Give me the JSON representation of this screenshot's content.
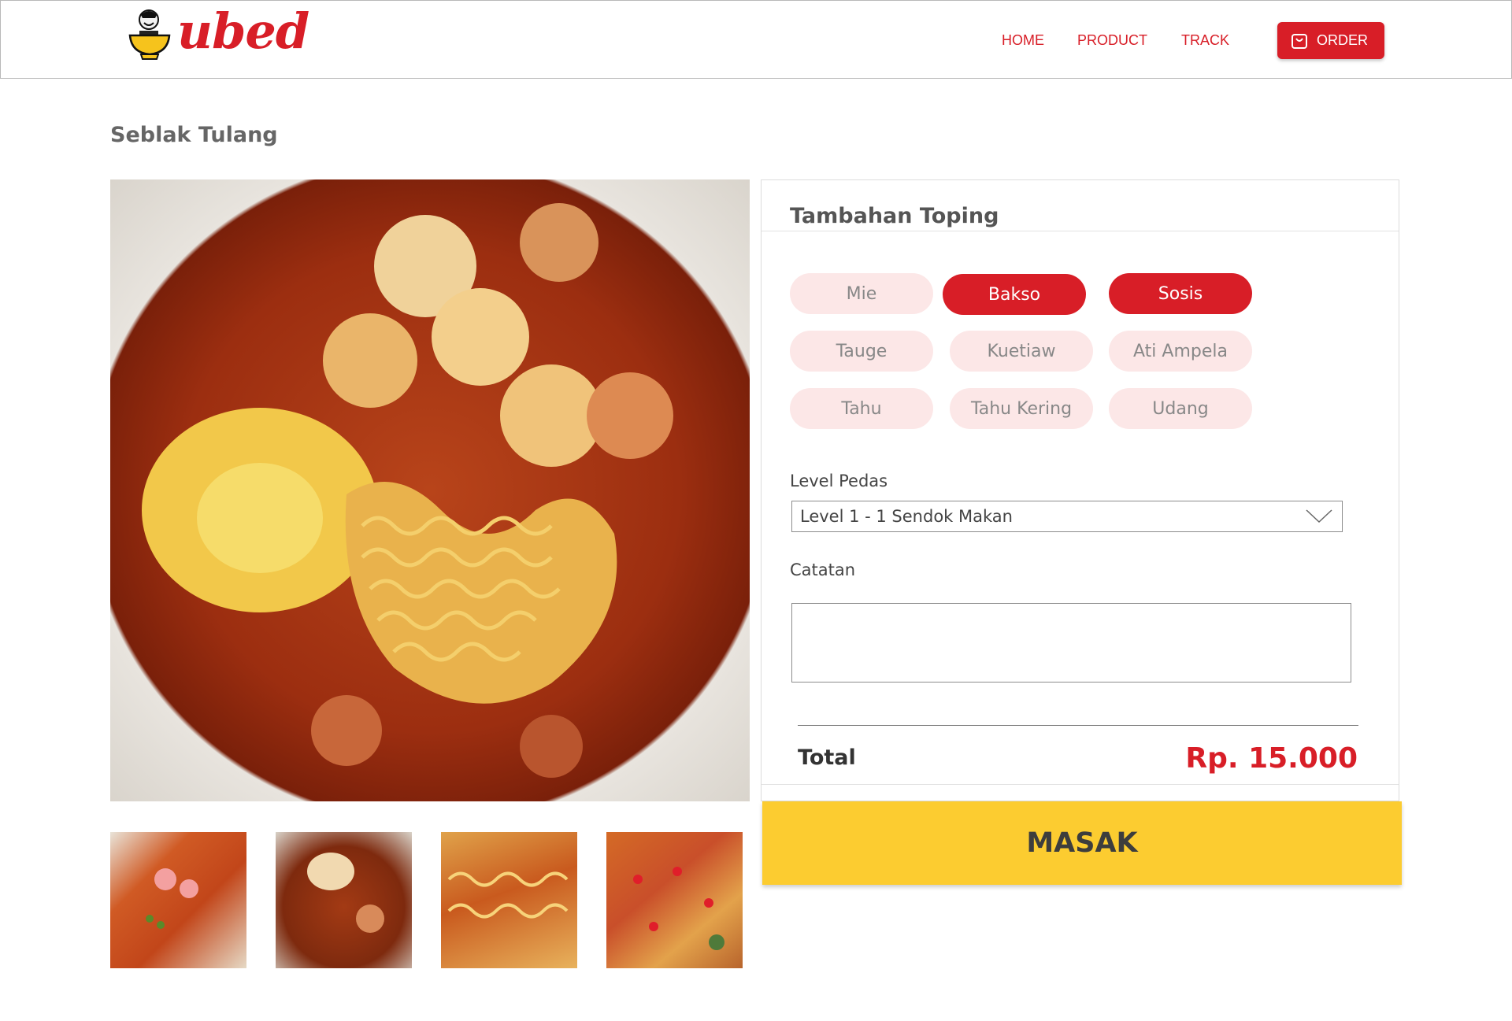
{
  "brand": {
    "name": "ubed",
    "color": "#d81e27",
    "logo_icon": "bowl-chef-icon"
  },
  "nav": {
    "home": "HOME",
    "product": "PRODUCT",
    "track": "TRACK",
    "order": "ORDER",
    "order_icon": "bag-icon"
  },
  "product": {
    "title": "Seblak Tulang",
    "main_image_icon": "seblak-photo",
    "thumbnails": [
      "seblak-photo-1",
      "seblak-photo-2",
      "seblak-photo-3",
      "seblak-photo-4"
    ]
  },
  "options": {
    "title": "Tambahan Toping",
    "toppings": [
      {
        "label": "Mie",
        "selected": false
      },
      {
        "label": "Bakso",
        "selected": true
      },
      {
        "label": "Sosis",
        "selected": true
      },
      {
        "label": "Tauge",
        "selected": false
      },
      {
        "label": "Kuetiaw",
        "selected": false
      },
      {
        "label": "Ati Ampela",
        "selected": false
      },
      {
        "label": "Tahu",
        "selected": false
      },
      {
        "label": "Tahu Kering",
        "selected": false
      },
      {
        "label": "Udang",
        "selected": false
      }
    ],
    "spice_label": "Level Pedas",
    "spice_value": "Level 1 - 1 Sendok Makan",
    "notes_label": "Catatan",
    "notes_value": "",
    "total_label": "Total",
    "total_value": "Rp. 15.000"
  },
  "action": {
    "label": "MASAK"
  },
  "colors": {
    "accent": "#d81e27",
    "chip_bg": "#fce7e7",
    "button_yellow": "#fccc30"
  }
}
